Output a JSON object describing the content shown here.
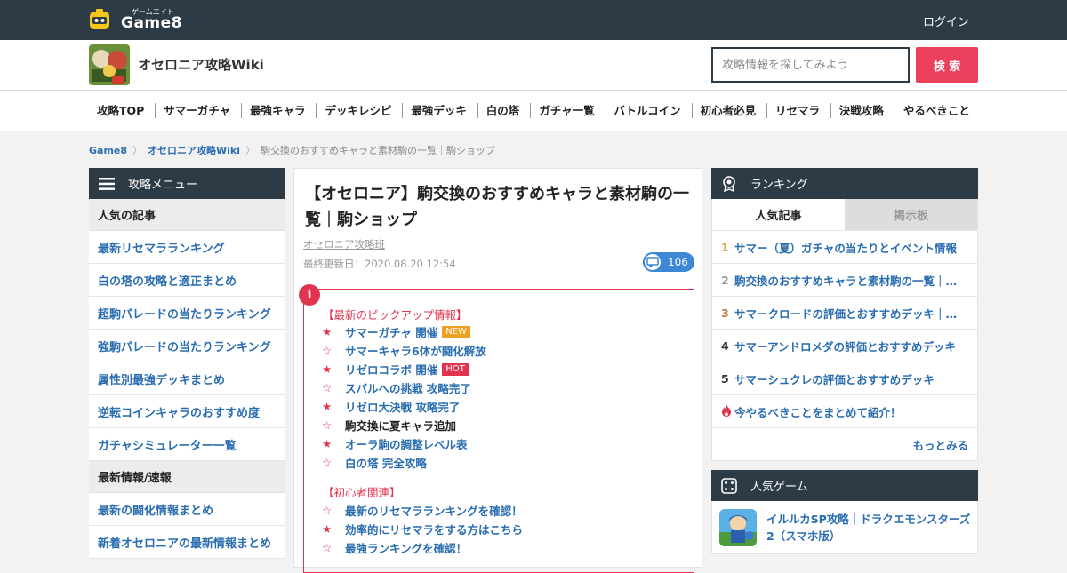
{
  "header": {
    "logo_kana": "ゲームエイト",
    "logo_text": "Game8",
    "login": "ログイン"
  },
  "site": {
    "name": "オセロニア攻略Wiki",
    "search_placeholder": "攻略情報を探してみよう",
    "search_button": "検 索"
  },
  "nav": [
    "攻略TOP",
    "サマーガチャ",
    "最強キャラ",
    "デッキレシピ",
    "最強デッキ",
    "白の塔",
    "ガチャ一覧",
    "バトルコイン",
    "初心者必見",
    "リセマラ",
    "決戦攻略",
    "やるべきこと"
  ],
  "breadcrumb": [
    "Game8",
    "オセロニア攻略Wiki",
    "駒交換のおすすめキャラと素材駒の一覧｜駒ショップ"
  ],
  "left_menu": {
    "title": "攻略メニュー",
    "section1": "人気の記事",
    "items1": [
      "最新リセマラランキング",
      "白の塔の攻略と適正まとめ",
      "超駒パレードの当たりランキング",
      "強駒パレードの当たりランキング",
      "属性別最強デッキまとめ",
      "逆転コインキャラのおすすめ度",
      "ガチャシミュレーター一覧"
    ],
    "section2": "最新情報/速報",
    "items2": [
      "最新の闘化情報まとめ",
      "新着オセロニアの最新情報まとめ"
    ]
  },
  "article": {
    "title": "【オセロニア】駒交換のおすすめキャラと素材駒の一覧｜駒ショップ",
    "author": "オセロニア攻略班",
    "date": "最終更新日：2020.08.20 12:54",
    "comments": "106",
    "pickup_heading": "【最新のピックアップ情報】",
    "pickup": [
      {
        "star": "★",
        "text": "サマーガチャ 開催",
        "badge": "NEW"
      },
      {
        "star": "☆",
        "text": "サマーキャラ6体が闘化解放",
        "badge": ""
      },
      {
        "star": "★",
        "text": "リゼロコラボ 開催",
        "badge": "HOT"
      },
      {
        "star": "☆",
        "text": "スバルへの挑戦 攻略完了",
        "badge": ""
      },
      {
        "star": "★",
        "text": "リゼロ大決戦 攻略完了",
        "badge": ""
      },
      {
        "star": "☆",
        "text": "駒交換に夏キャラ追加",
        "badge": ""
      },
      {
        "star": "★",
        "text": "オーラ駒の調整レベル表",
        "badge": ""
      },
      {
        "star": "☆",
        "text": "白の塔 完全攻略",
        "badge": ""
      }
    ],
    "beginner_heading": "【初心者関連】",
    "beginner": [
      {
        "star": "☆",
        "text": "最新のリセマラランキングを確認！"
      },
      {
        "star": "★",
        "text": "効率的にリセマラをする方はこちら"
      },
      {
        "star": "☆",
        "text": "最強ランキングを確認！"
      }
    ]
  },
  "ranking": {
    "title": "ランキング",
    "tab_active": "人気記事",
    "tab_inactive": "掲示板",
    "items": [
      {
        "num": "1",
        "text": "サマー（夏）ガチャの当たりとイベント情報",
        "color": "#d9a441"
      },
      {
        "num": "2",
        "text": "駒交換のおすすめキャラと素材駒の一覧｜駒ショップ",
        "color": "#999999"
      },
      {
        "num": "3",
        "text": "サマークロードの評価とおすすめデッキ｜闘化",
        "color": "#b5773c"
      },
      {
        "num": "4",
        "text": "サマーアンドロメダの評価とおすすめデッキ",
        "color": "#333333"
      },
      {
        "num": "5",
        "text": "サマーシュクレの評価とおすすめデッキ",
        "color": "#333333"
      }
    ],
    "hot_item": "今やるべきことをまとめて紹介！",
    "more": "もっとみる"
  },
  "games": {
    "title": "人気ゲーム",
    "item1": "イルルカSP攻略｜ドラクエモンスターズ2（スマホ版）"
  }
}
